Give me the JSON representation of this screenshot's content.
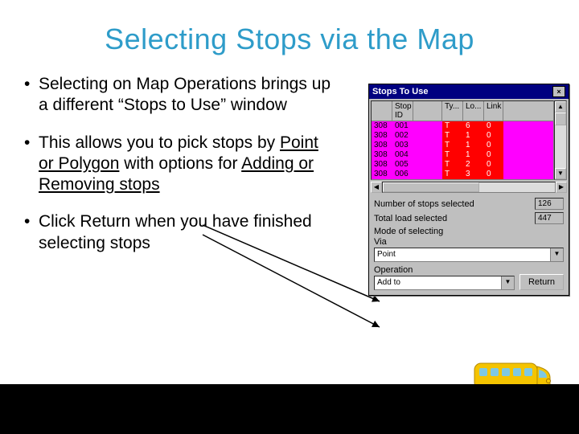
{
  "title": "Selecting Stops via the Map",
  "bullets": {
    "b1_a": "Selecting on Map Operations brings up a different “Stops to Use” window",
    "b2_a": "This allows you to pick stops by ",
    "b2_u1": "Point or Polygon",
    "b2_b": " with options for ",
    "b2_u2": "Adding or Removing stops",
    "b3_a": "Click Return when you have finished selecting stops"
  },
  "dialog": {
    "title": "Stops To Use",
    "headers": {
      "c0": "",
      "c1": "Stop ID",
      "c2": "",
      "c3": "Ty...",
      "c4": "Lo...",
      "c5": "Link"
    },
    "rows": [
      {
        "a": "308",
        "b": "001",
        "c": "",
        "d": "T",
        "e": "6",
        "f": "0"
      },
      {
        "a": "308",
        "b": "002",
        "c": "",
        "d": "T",
        "e": "1",
        "f": "0"
      },
      {
        "a": "308",
        "b": "003",
        "c": "",
        "d": "T",
        "e": "1",
        "f": "0"
      },
      {
        "a": "308",
        "b": "004",
        "c": "",
        "d": "T",
        "e": "1",
        "f": "0"
      },
      {
        "a": "308",
        "b": "005",
        "c": "",
        "d": "T",
        "e": "2",
        "f": "0"
      },
      {
        "a": "308",
        "b": "006",
        "c": "",
        "d": "T",
        "e": "3",
        "f": "0"
      }
    ],
    "num_selected_label": "Number of stops selected",
    "num_selected": "126",
    "load_label": "Total load selected",
    "load_value": "447",
    "mode_label": "Mode of selecting",
    "via_label": "Via",
    "via_value": "Point",
    "op_label": "Operation",
    "op_value": "Add to",
    "return_label": "Return"
  }
}
